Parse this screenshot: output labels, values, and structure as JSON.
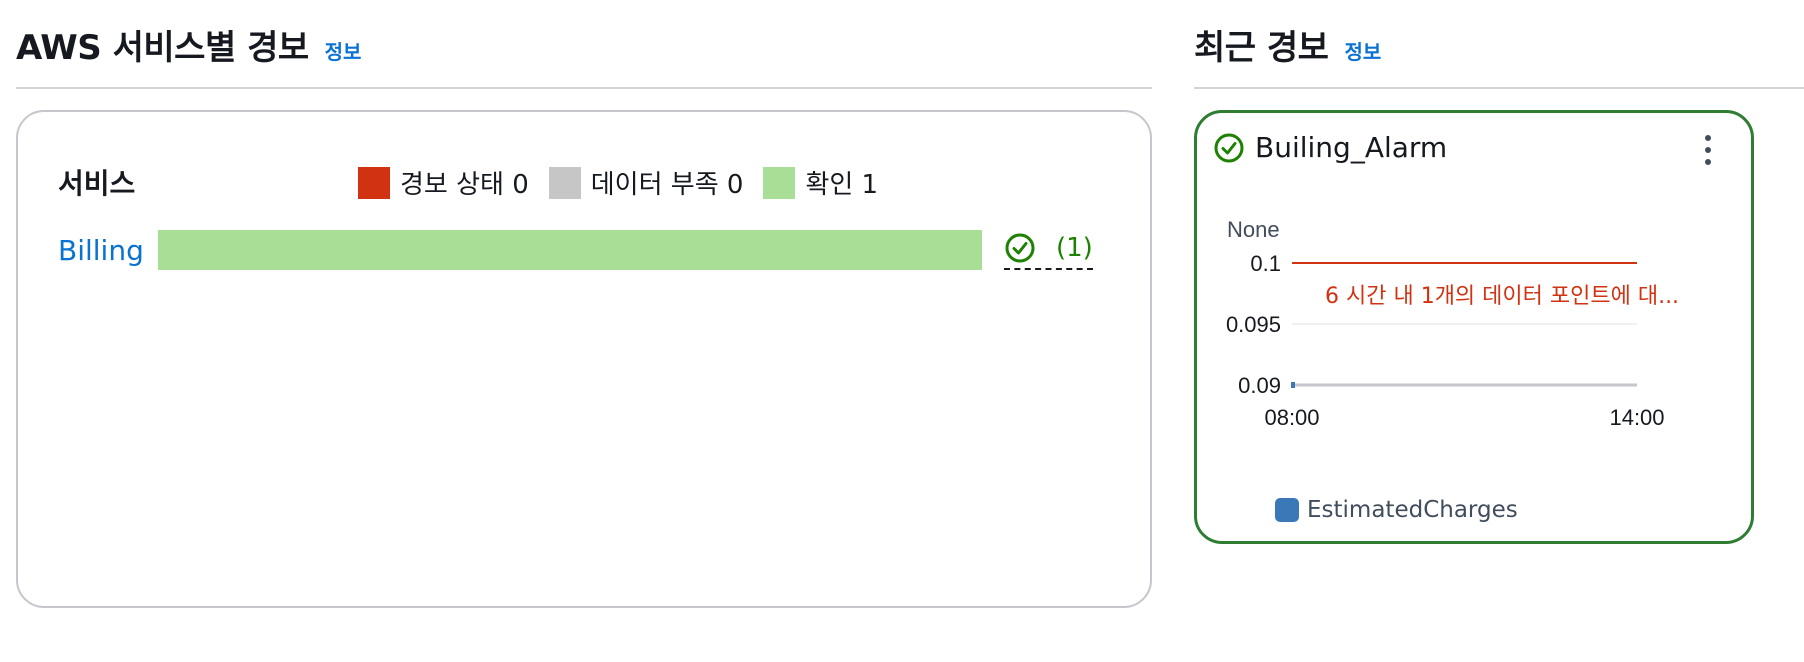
{
  "left_section": {
    "title": "AWS 서비스별 경보",
    "info_link": "정보"
  },
  "right_section": {
    "title": "최근 경보",
    "info_link": "정보"
  },
  "services_panel": {
    "heading": "서비스",
    "legend": [
      {
        "label": "경보 상태 0",
        "color": "#d13212"
      },
      {
        "label": "데이터 부족 0",
        "color": "#c6c6c6"
      },
      {
        "label": "확인 1",
        "color": "#a8de95"
      }
    ],
    "rows": [
      {
        "service": "Billing",
        "ok_count": "(1)",
        "ok_fraction": 1.0
      }
    ]
  },
  "alarm_card": {
    "name": "Builing_Alarm",
    "status_color": "#1d8102",
    "legend_label": "EstimatedCharges",
    "series_color": "#3a78b7",
    "threshold_color": "#d13212"
  },
  "chart_data": {
    "type": "line",
    "ylabel": "None",
    "yticks": [
      "0.1",
      "0.095",
      "0.09"
    ],
    "xticks": [
      "08:00",
      "14:00"
    ],
    "ylim": [
      0.09,
      0.1
    ],
    "threshold": {
      "value": 0.1,
      "label": "6 시간 내 1개의 데이터 포인트에 대..."
    },
    "series": [
      {
        "name": "EstimatedCharges",
        "x": [
          "08:00"
        ],
        "values": [
          0.09
        ]
      }
    ]
  }
}
